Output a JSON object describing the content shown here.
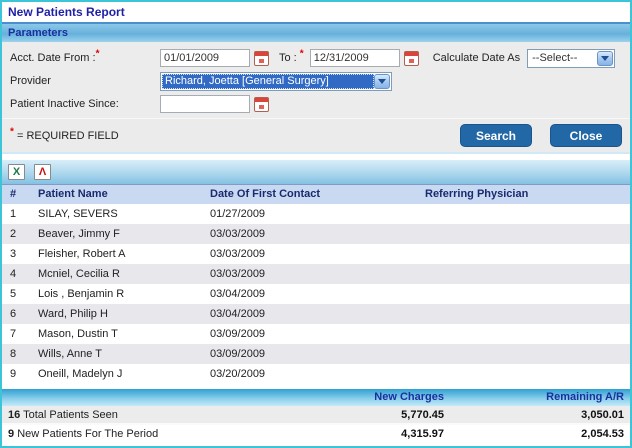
{
  "window": {
    "title": "New Patients Report"
  },
  "colors": {
    "accent_button": "#2268A6",
    "selection_blue": "#316AC5",
    "window_border": "#3CC5D8",
    "table_header_bg": "#C9D9F2"
  },
  "parameters": {
    "section_title": "Parameters",
    "required_marker": "*",
    "acct_date_label": "Acct. Date From :",
    "date_from_value": "01/01/2009",
    "to_label": "To :",
    "date_to_value": "12/31/2009",
    "calculate_date_label": "Calculate Date As",
    "calculate_date_value": "--Select--",
    "provider_label": "Provider",
    "provider_value": "Richard, Joetta [General Surgery]",
    "inactive_label": "Patient Inactive Since:",
    "inactive_value": "",
    "required_note": "= REQUIRED FIELD",
    "search_button": "Search",
    "close_button": "Close"
  },
  "toolbar": {
    "excel_icon_glyph": "X",
    "pdf_icon_glyph": "Λ"
  },
  "table": {
    "columns": [
      "#",
      "Patient Name",
      "Date Of First Contact",
      "Referring Physician"
    ],
    "rows": [
      {
        "num": "1",
        "name": "SILAY, SEVERS",
        "date": "01/27/2009",
        "referring": ""
      },
      {
        "num": "2",
        "name": "Beaver, Jimmy F",
        "date": "03/03/2009",
        "referring": ""
      },
      {
        "num": "3",
        "name": "Fleisher, Robert A",
        "date": "03/03/2009",
        "referring": ""
      },
      {
        "num": "4",
        "name": "Mcniel, Cecilia R",
        "date": "03/03/2009",
        "referring": ""
      },
      {
        "num": "5",
        "name": "Lois , Benjamin R",
        "date": "03/04/2009",
        "referring": ""
      },
      {
        "num": "6",
        "name": "Ward, Philip H",
        "date": "03/04/2009",
        "referring": ""
      },
      {
        "num": "7",
        "name": "Mason, Dustin T",
        "date": "03/09/2009",
        "referring": ""
      },
      {
        "num": "8",
        "name": "Wills, Anne T",
        "date": "03/09/2009",
        "referring": ""
      },
      {
        "num": "9",
        "name": "Oneill, Madelyn J",
        "date": "03/20/2009",
        "referring": ""
      }
    ]
  },
  "totals": {
    "new_charges_header": "New Charges",
    "remaining_ar_header": "Remaining A/R",
    "rows": [
      {
        "count": "16",
        "label": "Total Patients Seen",
        "new_charges": "5,770.45",
        "remaining_ar": "3,050.01"
      },
      {
        "count": "9",
        "label": "New Patients For The Period",
        "new_charges": "4,315.97",
        "remaining_ar": "2,054.53"
      }
    ]
  }
}
